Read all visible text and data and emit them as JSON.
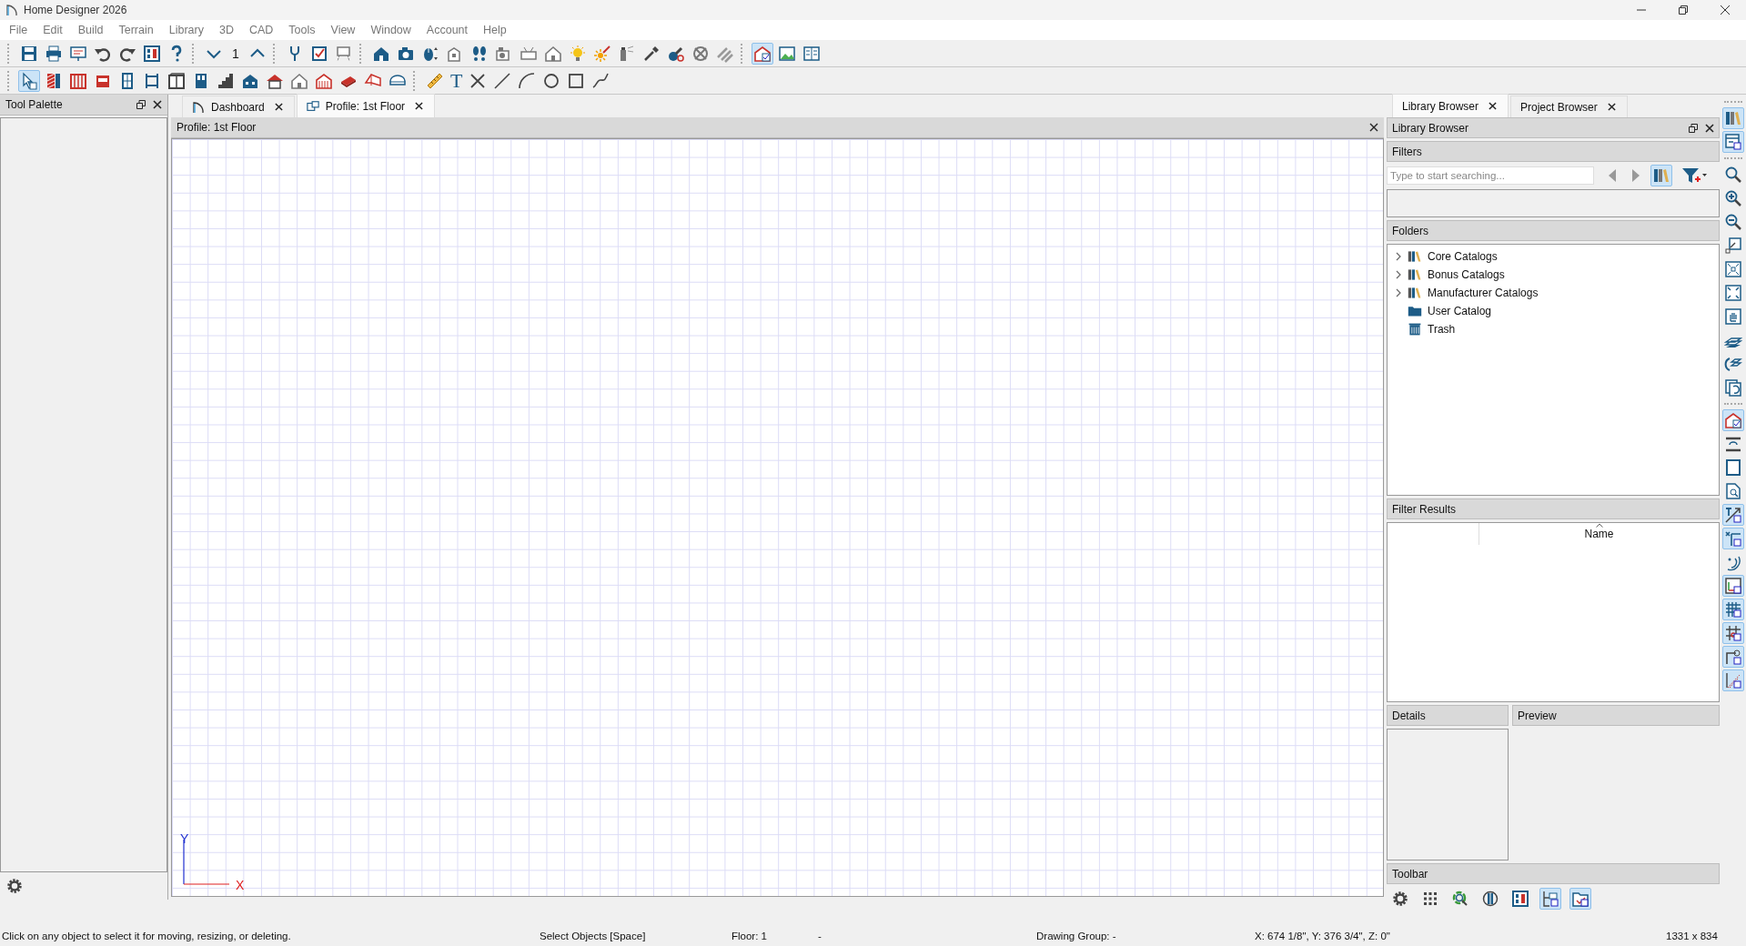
{
  "window": {
    "title": "Home Designer 2026"
  },
  "menu": [
    "File",
    "Edit",
    "Build",
    "Terrain",
    "Library",
    "3D",
    "CAD",
    "Tools",
    "View",
    "Window",
    "Account",
    "Help"
  ],
  "toolbar_1": [
    [
      {
        "kind": "button",
        "pressed": false
      },
      {
        "kind": "button",
        "pressed": false
      },
      {
        "kind": "button",
        "pressed": false
      },
      {
        "kind": "button",
        "pressed": false
      },
      {
        "kind": "button",
        "pressed": false
      },
      {
        "kind": "button",
        "pressed": false
      },
      {
        "kind": "button",
        "pressed": false
      }
    ],
    [
      {
        "kind": "button",
        "pressed": false
      },
      {
        "kind": "label",
        "text": "1"
      },
      {
        "kind": "button",
        "pressed": false
      }
    ],
    [
      {
        "kind": "button",
        "pressed": false
      },
      {
        "kind": "button",
        "pressed": false
      },
      {
        "kind": "button",
        "pressed": false
      }
    ],
    [
      {
        "kind": "button",
        "pressed": false
      },
      {
        "kind": "button",
        "pressed": false
      },
      {
        "kind": "button",
        "pressed": false
      },
      {
        "kind": "button",
        "pressed": false
      },
      {
        "kind": "button",
        "pressed": false
      },
      {
        "kind": "button",
        "pressed": false
      },
      {
        "kind": "button",
        "pressed": false
      },
      {
        "kind": "button",
        "pressed": false
      },
      {
        "kind": "button",
        "pressed": false
      },
      {
        "kind": "button",
        "pressed": false
      },
      {
        "kind": "button",
        "pressed": false
      },
      {
        "kind": "button",
        "pressed": false
      },
      {
        "kind": "button",
        "pressed": false
      },
      {
        "kind": "button",
        "pressed": false
      },
      {
        "kind": "button",
        "pressed": false
      }
    ],
    [
      {
        "kind": "button",
        "pressed": true
      },
      {
        "kind": "button",
        "pressed": false
      },
      {
        "kind": "button",
        "pressed": false
      }
    ]
  ],
  "toolbar_2": [
    [
      {
        "kind": "button",
        "pressed": true
      },
      {
        "kind": "button",
        "pressed": false
      },
      {
        "kind": "button",
        "pressed": false
      },
      {
        "kind": "button",
        "pressed": false
      },
      {
        "kind": "button",
        "pressed": false
      },
      {
        "kind": "button",
        "pressed": false
      },
      {
        "kind": "button",
        "pressed": false
      },
      {
        "kind": "button",
        "pressed": false
      },
      {
        "kind": "button",
        "pressed": false
      },
      {
        "kind": "button",
        "pressed": false
      },
      {
        "kind": "button",
        "pressed": false
      },
      {
        "kind": "button",
        "pressed": false
      },
      {
        "kind": "button",
        "pressed": false
      },
      {
        "kind": "button",
        "pressed": false
      },
      {
        "kind": "button",
        "pressed": false
      },
      {
        "kind": "button",
        "pressed": false
      }
    ],
    [
      {
        "kind": "button",
        "pressed": false
      },
      {
        "kind": "label",
        "text": "T"
      },
      {
        "kind": "button",
        "pressed": false
      },
      {
        "kind": "button",
        "pressed": false
      },
      {
        "kind": "button",
        "pressed": false
      },
      {
        "kind": "button",
        "pressed": false
      },
      {
        "kind": "button",
        "pressed": false
      },
      {
        "kind": "button",
        "pressed": false
      }
    ]
  ],
  "tool_palette": {
    "title": "Tool Palette"
  },
  "document_tabs": [
    {
      "label": "Dashboard",
      "selected": false
    },
    {
      "label": "Profile: 1st Floor",
      "selected": true
    }
  ],
  "view": {
    "title": "Profile: 1st Floor",
    "y_axis_label": "Y",
    "x_axis_label": "X"
  },
  "browser_tabs": [
    {
      "label": "Library Browser",
      "selected": true
    },
    {
      "label": "Project Browser",
      "selected": false
    }
  ],
  "library_browser": {
    "title": "Library Browser",
    "filters_heading": "Filters",
    "search": {
      "placeholder": "Type to start searching..."
    },
    "folders_heading": "Folders",
    "folders": [
      {
        "label": "Core Catalogs",
        "kind": "catalog",
        "has_children": true,
        "expanded": false
      },
      {
        "label": "Bonus Catalogs",
        "kind": "catalog",
        "has_children": true,
        "expanded": false
      },
      {
        "label": "Manufacturer Catalogs",
        "kind": "catalog",
        "has_children": true,
        "expanded": false
      },
      {
        "label": "User Catalog",
        "kind": "folder",
        "has_children": false,
        "expanded": false
      },
      {
        "label": "Trash",
        "kind": "trash",
        "has_children": false,
        "expanded": false
      }
    ],
    "results_heading": "Filter Results",
    "results_column": {
      "label": "Name",
      "sorted_ascending": true
    },
    "details_heading": "Details",
    "preview_heading": "Preview",
    "toolbar_heading": "Toolbar",
    "toolbar": [
      {
        "pressed": false
      },
      {
        "pressed": false
      },
      {
        "pressed": false
      },
      {
        "pressed": false
      },
      {
        "pressed": false
      },
      {
        "pressed": true
      },
      {
        "pressed": true
      }
    ]
  },
  "side_toolbar": [
    [
      {
        "pressed": true
      },
      {
        "pressed": true
      }
    ],
    [
      {
        "pressed": false
      },
      {
        "pressed": false
      },
      {
        "pressed": false
      },
      {
        "pressed": false
      },
      {
        "pressed": false
      },
      {
        "pressed": false
      },
      {
        "pressed": false
      },
      {
        "pressed": false
      },
      {
        "pressed": false
      },
      {
        "pressed": false
      }
    ],
    [
      {
        "pressed": true
      },
      {
        "pressed": false
      },
      {
        "pressed": false
      },
      {
        "pressed": false
      },
      {
        "pressed": true
      },
      {
        "pressed": true
      },
      {
        "pressed": false
      },
      {
        "pressed": true
      },
      {
        "pressed": true
      },
      {
        "pressed": true
      },
      {
        "pressed": true
      },
      {
        "pressed": true
      }
    ]
  ],
  "status_bar": [
    "Click on any object to select it for moving, resizing, or deleting.",
    "Select Objects [Space]",
    "Floor: 1",
    "-",
    "Drawing Group: -",
    "X: 674 1/8\", Y: 376 3/4\", Z: 0\"",
    "1331 x 834"
  ]
}
